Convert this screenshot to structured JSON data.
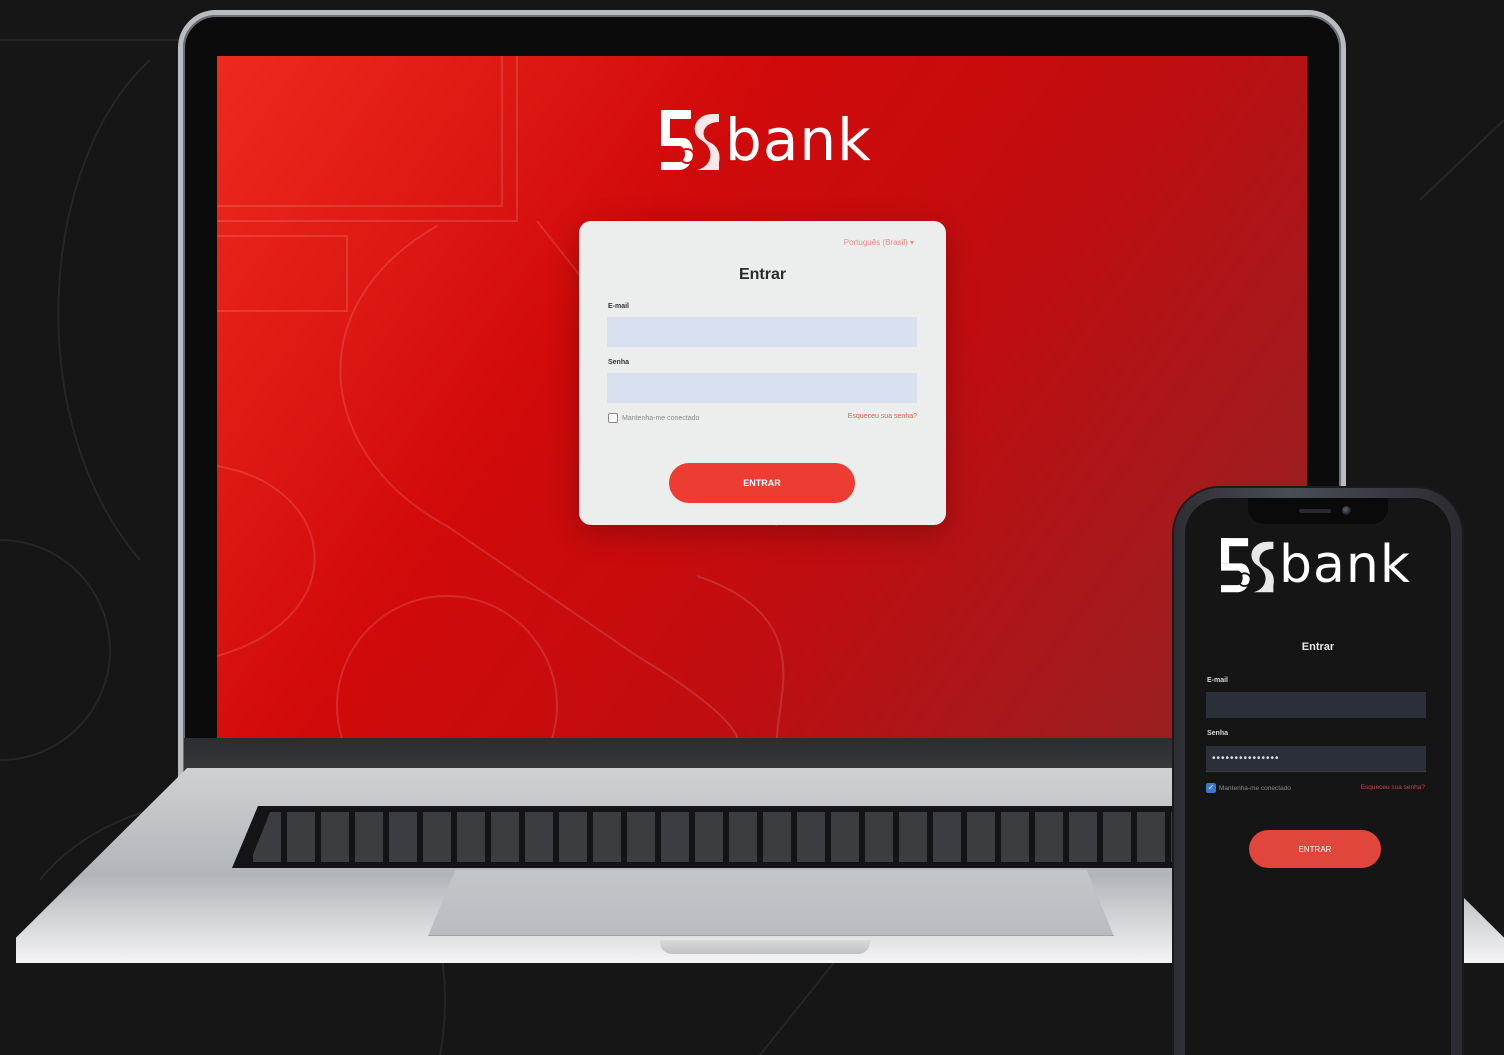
{
  "brand": {
    "name": "bank",
    "mark": "5S",
    "primary_color": "#e0261d",
    "button_color": "#ed3d33"
  },
  "laptop": {
    "language": "Português (Brasil) ▾",
    "title": "Entrar",
    "email_label": "E-mail",
    "email_value": "",
    "password_label": "Senha",
    "password_value": "",
    "remember_label": "Mantenha-me conectado",
    "remember_checked": false,
    "forgot_label": "Esqueceu sua senha?",
    "submit_label": "ENTRAR"
  },
  "phone": {
    "title": "Entrar",
    "email_label": "E-mail",
    "email_value": "",
    "password_label": "Senha",
    "password_value": "•••••••••••••••",
    "remember_label": "Mantenha-me conectado",
    "remember_checked": true,
    "forgot_label": "Esqueceu sua senha?",
    "submit_label": "ENTRAR"
  }
}
